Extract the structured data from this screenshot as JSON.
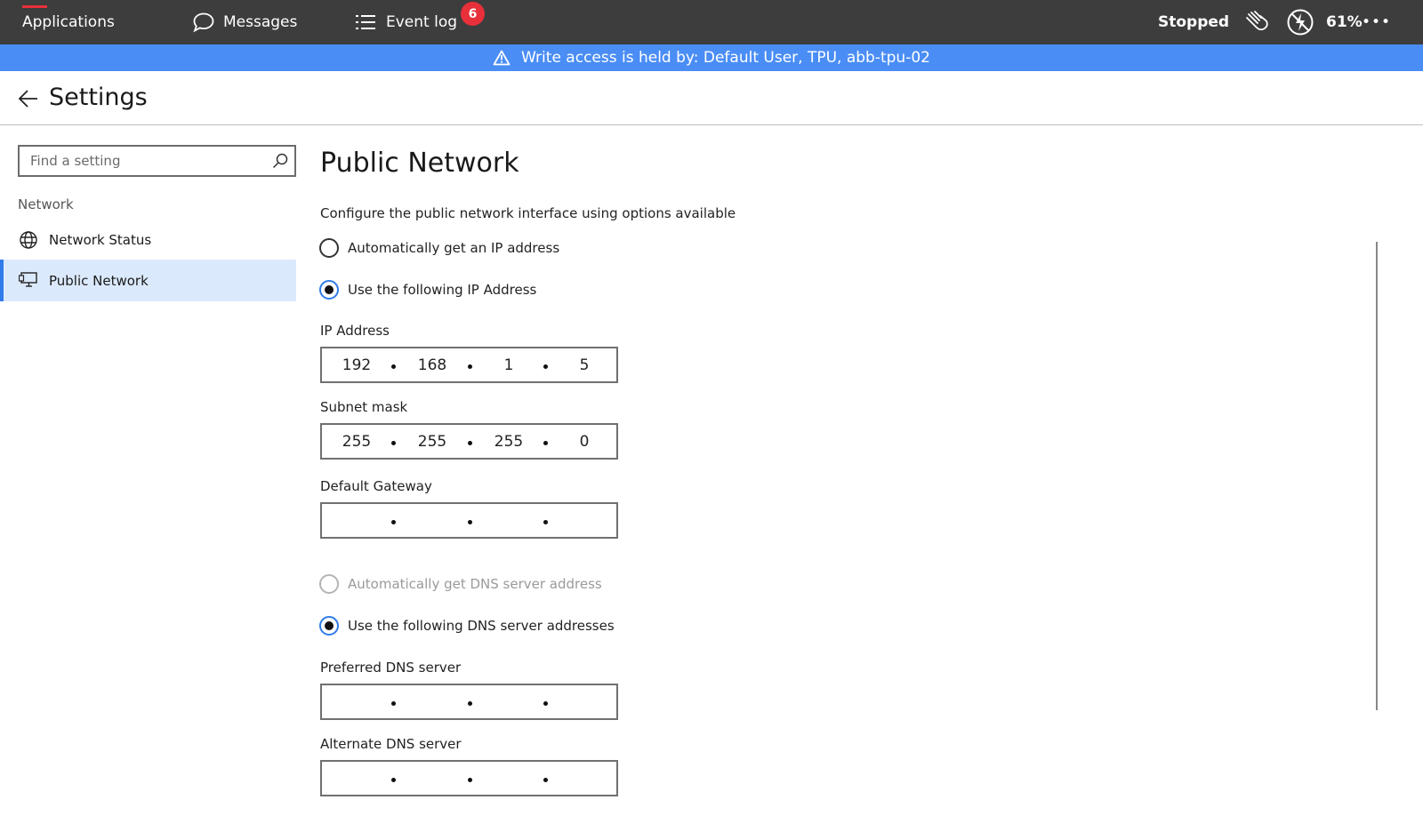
{
  "topbar": {
    "applications": "Applications",
    "messages": "Messages",
    "event_log": "Event log",
    "event_count": "6",
    "status": "Stopped",
    "battery": "61%",
    "more": "•••"
  },
  "banner": {
    "text": "Write access is held by: Default User, TPU, abb-tpu-02"
  },
  "header": {
    "title": "Settings"
  },
  "sidebar": {
    "search_placeholder": "Find a setting",
    "section": "Network",
    "items": [
      {
        "label": "Network Status",
        "icon": "globe-icon",
        "active": false
      },
      {
        "label": "Public Network",
        "icon": "network-adapter-icon",
        "active": true
      }
    ]
  },
  "main": {
    "heading": "Public Network",
    "description": "Configure the public network interface using options available",
    "ip_mode": {
      "auto": "Automatically get an IP address",
      "manual": "Use the following IP Address",
      "selected": "manual"
    },
    "ip_address": {
      "label": "IP Address",
      "octets": [
        "192",
        "168",
        "1",
        "5"
      ]
    },
    "subnet_mask": {
      "label": "Subnet mask",
      "octets": [
        "255",
        "255",
        "255",
        "0"
      ]
    },
    "default_gateway": {
      "label": "Default Gateway",
      "octets": [
        "",
        "",
        "",
        ""
      ]
    },
    "dns_mode": {
      "auto": "Automatically get DNS server address",
      "manual": "Use the following DNS server addresses",
      "selected": "manual",
      "auto_disabled": true
    },
    "preferred_dns": {
      "label": "Preferred DNS server",
      "octets": [
        "",
        "",
        "",
        ""
      ]
    },
    "alternate_dns": {
      "label": "Alternate DNS server",
      "octets": [
        "",
        "",
        "",
        ""
      ]
    }
  },
  "colors": {
    "topbar": "#3d3d3d",
    "banner": "#4a8df5",
    "accent": "#2f7bea",
    "badge": "#e8303a",
    "active_nav": "#dbe9fc"
  }
}
